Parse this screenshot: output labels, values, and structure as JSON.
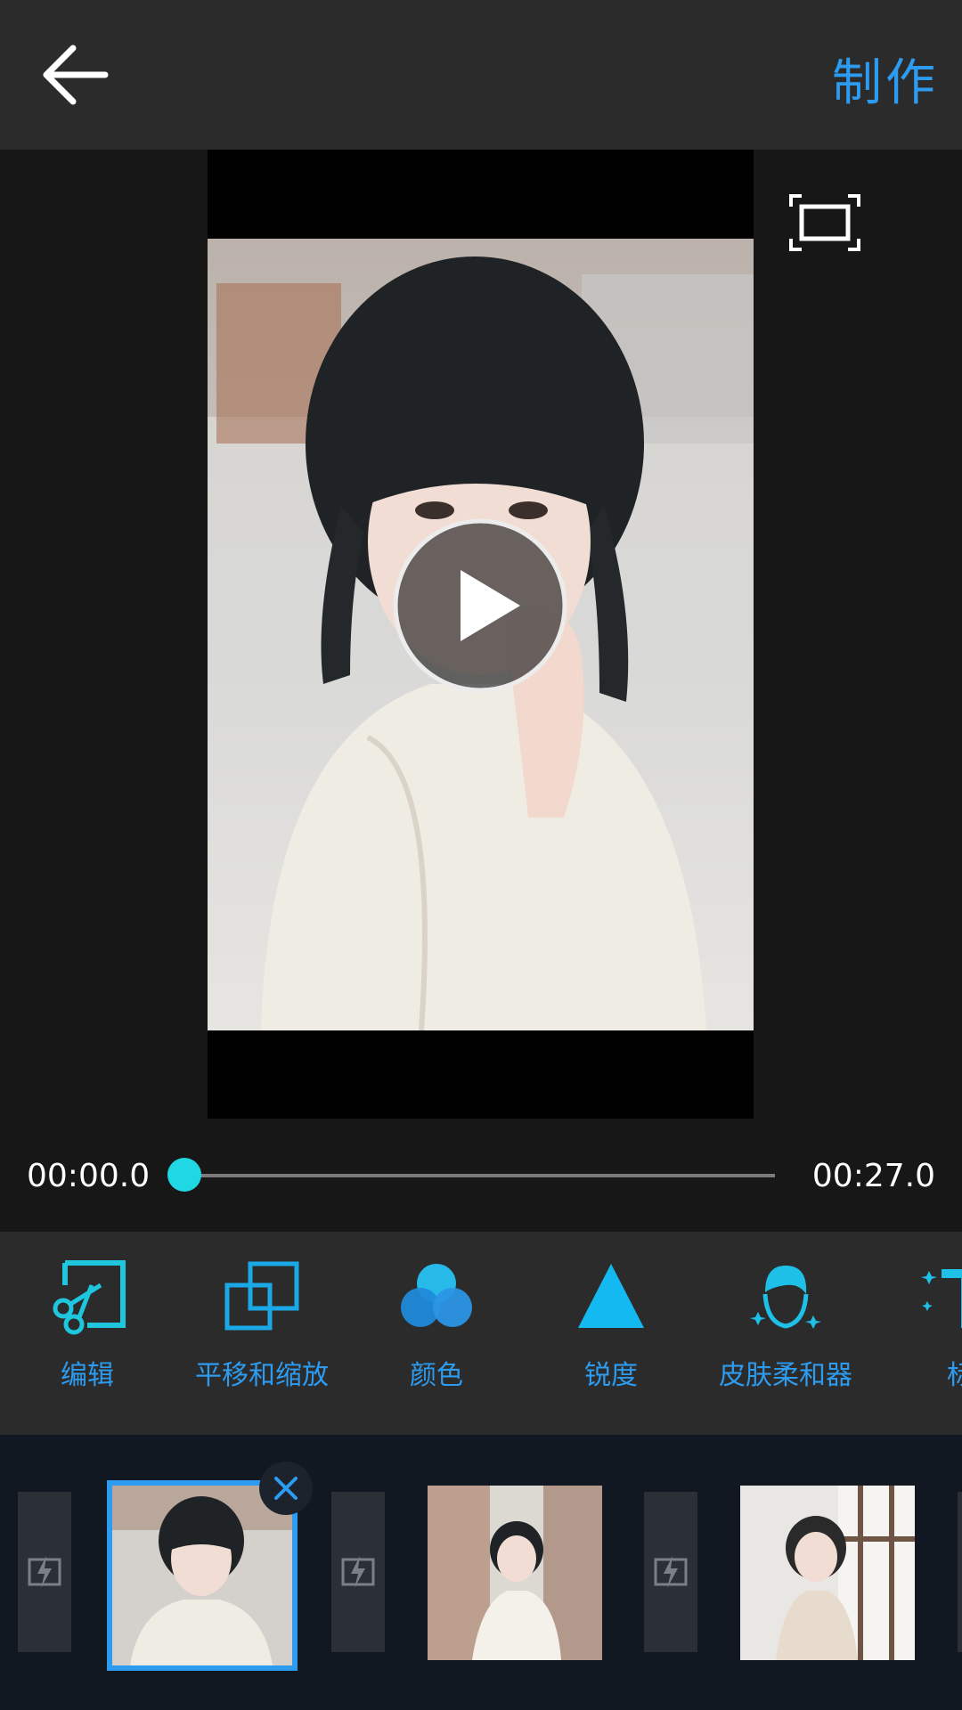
{
  "header": {
    "make_label": "制作"
  },
  "player": {
    "current_time": "00:00.0",
    "total_time": "00:27.0",
    "progress": 0,
    "accent_color": "#1fd8e4"
  },
  "tools": [
    {
      "label": "编辑",
      "icon": "scissors-edit-icon"
    },
    {
      "label": "平移和缩放",
      "icon": "pan-zoom-icon"
    },
    {
      "label": "颜色",
      "icon": "color-circles-icon"
    },
    {
      "label": "锐度",
      "icon": "triangle-sharpness-icon"
    },
    {
      "label": "皮肤柔和器",
      "icon": "face-sparkle-icon"
    },
    {
      "label": "标",
      "icon": "text-icon"
    }
  ],
  "clips": {
    "selected_index": 0,
    "count": 3
  },
  "colors": {
    "accent_blue": "#2d9cf0",
    "header_bg": "#2b2b2b"
  }
}
